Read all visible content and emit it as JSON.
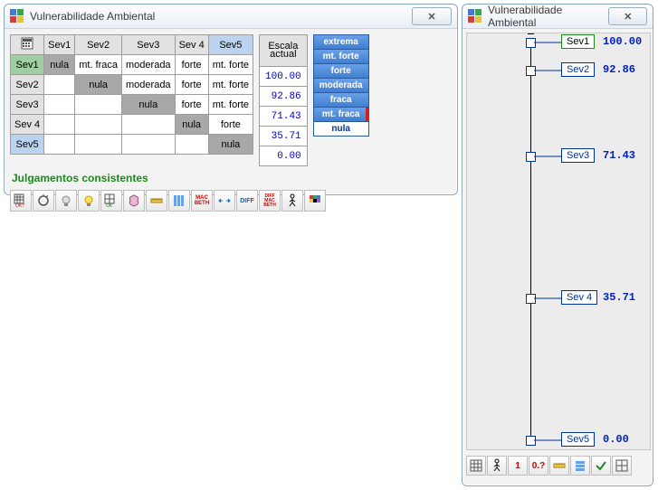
{
  "left_window": {
    "title": "Vulnerabilidade Ambiental",
    "close_glyph": "✕",
    "columns": [
      "Sev1",
      "Sev2",
      "Sev3",
      "Sev 4",
      "Sev5"
    ],
    "rows": [
      "Sev1",
      "Sev2",
      "Sev3",
      "Sev 4",
      "Sev5"
    ],
    "selected_row_index": 0,
    "selected_col_index": 4,
    "cells": [
      [
        "nula",
        "mt. fraca",
        "moderada",
        "forte",
        "mt. forte"
      ],
      [
        "",
        "nula",
        "moderada",
        "forte",
        "mt. forte"
      ],
      [
        "",
        "",
        "nula",
        "forte",
        "mt. forte"
      ],
      [
        "",
        "",
        "",
        "nula",
        "forte"
      ],
      [
        "",
        "",
        "",
        "",
        "nula"
      ]
    ],
    "escala_header1": "Escala",
    "escala_header2": "actual",
    "escala_values": [
      "100.00",
      "92.86",
      "71.43",
      "35.71",
      "0.00"
    ],
    "legend": [
      "extrema",
      "mt. forte",
      "forte",
      "moderada",
      "fraca",
      "mt. fraca",
      "nula"
    ],
    "legend_selected_index": 5,
    "status": "Julgamentos consistentes",
    "toolbar_names": [
      "grid-ok",
      "reset",
      "bulb-off",
      "bulb-on",
      "grid-plus",
      "brain",
      "ruler",
      "columns",
      "macbeth",
      "arrows",
      "diff",
      "macbeth-diff",
      "stick-figure",
      "palette"
    ]
  },
  "right_window": {
    "title": "Vulnerabilidade Ambiental",
    "close_glyph": "✕",
    "axis_min": 0,
    "axis_max": 100,
    "items": [
      {
        "label": "Sev1",
        "value": "100.00",
        "pos": 100,
        "selected": true
      },
      {
        "label": "Sev2",
        "value": "92.86",
        "pos": 92.86,
        "selected": false
      },
      {
        "label": "Sev3",
        "value": "71.43",
        "pos": 71.43,
        "selected": false
      },
      {
        "label": "Sev 4",
        "value": "35.71",
        "pos": 35.71,
        "selected": false
      },
      {
        "label": "Sev5",
        "value": "0.00",
        "pos": 0,
        "selected": false
      }
    ],
    "toolbar": {
      "grid": "",
      "stick": "",
      "num1": "1",
      "num0q": "0.?",
      "ruler": "",
      "stack": "",
      "check": "",
      "grid2": ""
    }
  },
  "chart_data": {
    "type": "table",
    "title": "Vulnerabilidade Ambiental — escala actual",
    "categories": [
      "Sev1",
      "Sev2",
      "Sev3",
      "Sev 4",
      "Sev5"
    ],
    "values": [
      100.0,
      92.86,
      71.43,
      35.71,
      0.0
    ],
    "ylim": [
      0,
      100
    ]
  }
}
